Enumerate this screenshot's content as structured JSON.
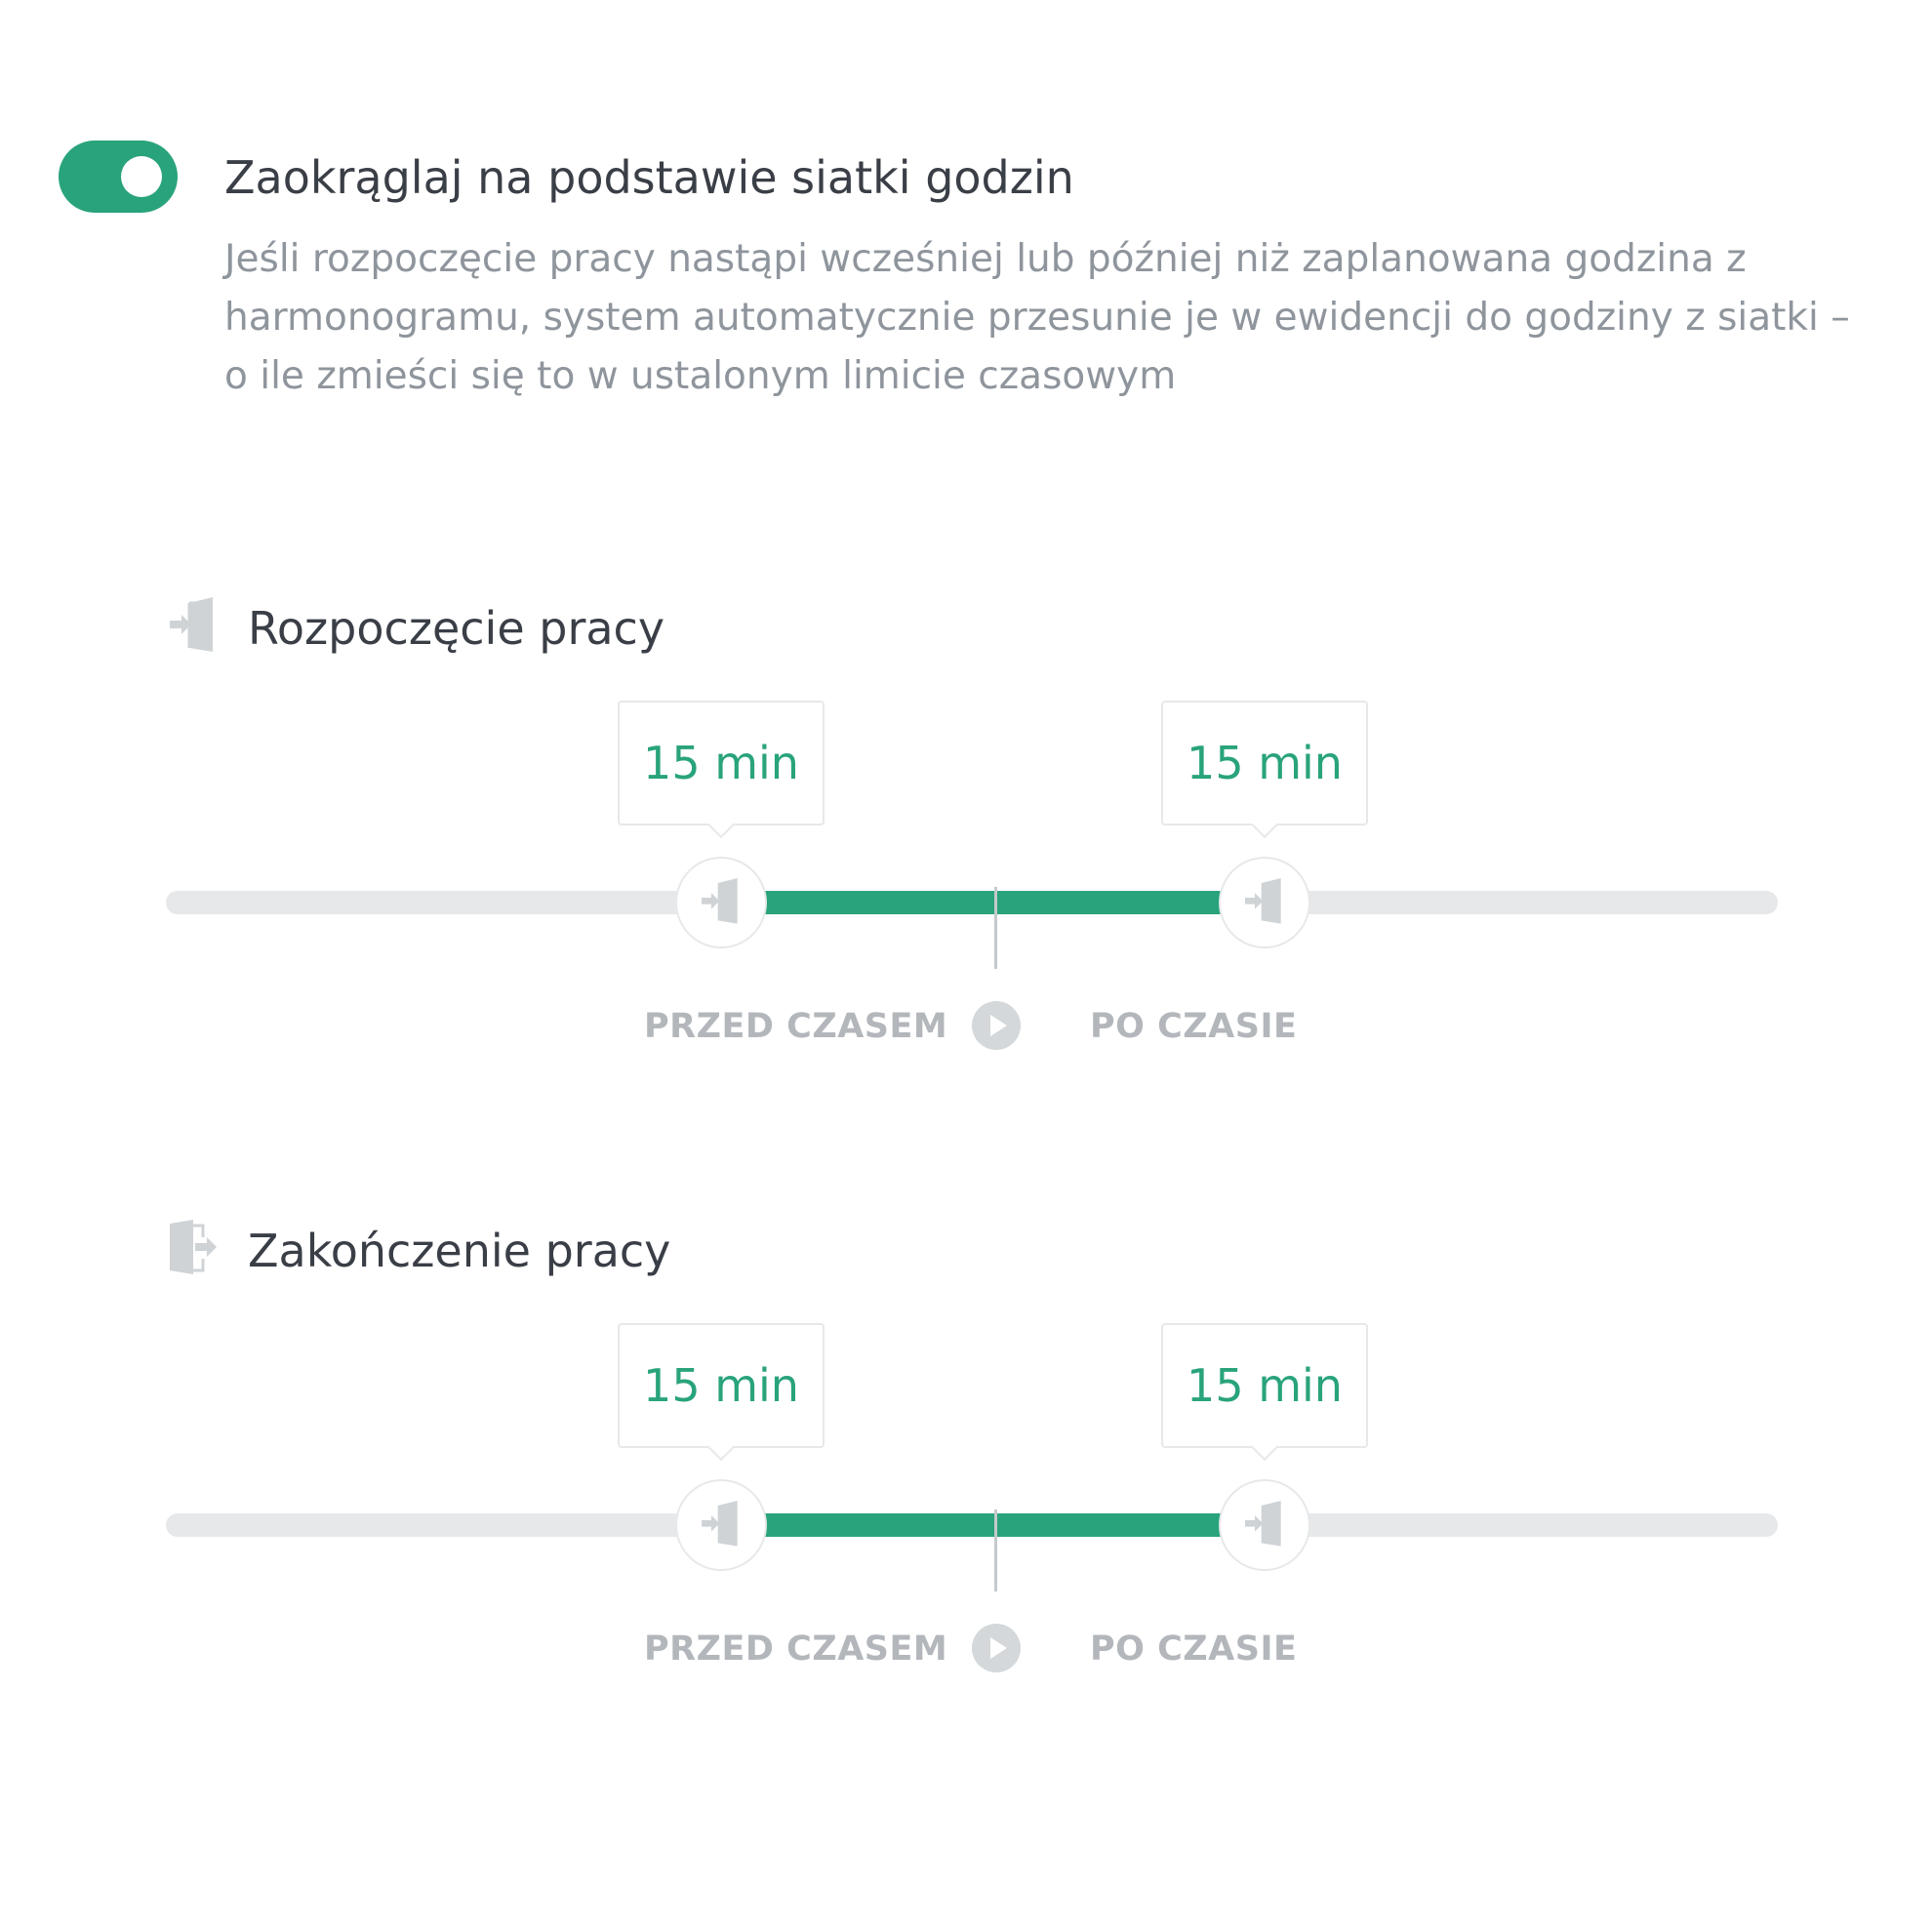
{
  "setting": {
    "toggle_on": true,
    "title": "Zaokrąglaj na podstawie siatki godzin",
    "description": "Jeśli rozpoczęcie pracy nastąpi wcześniej lub później niż zaplanowana godzina z harmonogramu, system automatycznie przesunie je w ewidencji do godziny z siatki – o ile zmieści się to w ustalonym limicie czasowym"
  },
  "sections": [
    {
      "icon": "door-enter-icon",
      "title": "Rozpoczęcie pracy",
      "before_value": "15 min",
      "after_value": "15 min",
      "before_label": "PRZED CZASEM",
      "after_label": "PO CZASIE"
    },
    {
      "icon": "door-exit-icon",
      "title": "Zakończenie pracy",
      "before_value": "15 min",
      "after_value": "15 min",
      "before_label": "PRZED CZASEM",
      "after_label": "PO CZASIE"
    }
  ],
  "colors": {
    "accent": "#29a37c",
    "track": "#e6e8ea",
    "muted_text": "#8f959c",
    "label": "#b3b7bb"
  }
}
